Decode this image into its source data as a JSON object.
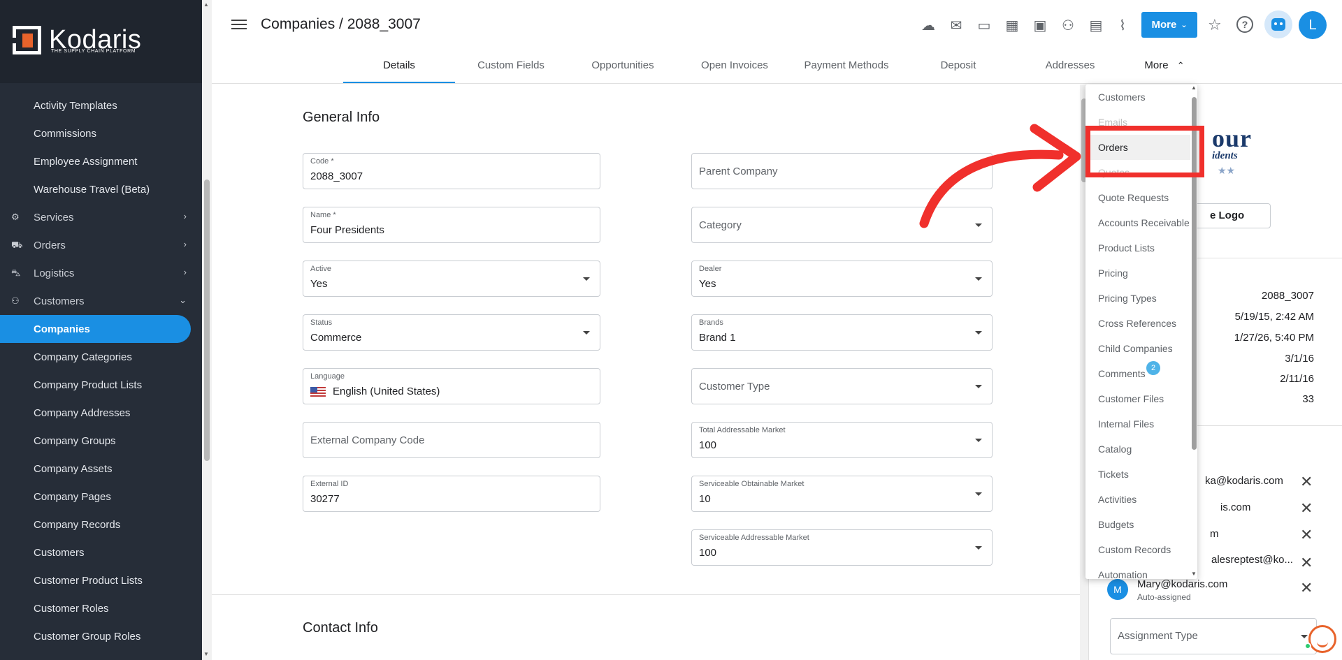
{
  "brand": {
    "name": "Kodaris",
    "tagline": "THE SUPPLY CHAIN PLATFORM",
    "accent": "#1a8fe3",
    "logo_color": "#e8632b"
  },
  "sidebar": {
    "items": [
      {
        "label": "Activity Templates",
        "type": "sub"
      },
      {
        "label": "Commissions",
        "type": "sub"
      },
      {
        "label": "Employee Assignment",
        "type": "sub"
      },
      {
        "label": "Warehouse Travel (Beta)",
        "type": "sub"
      },
      {
        "label": "Services",
        "type": "group",
        "icon": "services-icon"
      },
      {
        "label": "Orders",
        "type": "group",
        "icon": "truck-icon"
      },
      {
        "label": "Logistics",
        "type": "group",
        "icon": "logistics-icon"
      },
      {
        "label": "Customers",
        "type": "group",
        "icon": "people-icon"
      },
      {
        "label": "Companies",
        "type": "active"
      },
      {
        "label": "Company Categories",
        "type": "sub"
      },
      {
        "label": "Company Product Lists",
        "type": "sub"
      },
      {
        "label": "Company Addresses",
        "type": "sub"
      },
      {
        "label": "Company Groups",
        "type": "sub"
      },
      {
        "label": "Company Assets",
        "type": "sub"
      },
      {
        "label": "Company Pages",
        "type": "sub"
      },
      {
        "label": "Company Records",
        "type": "sub"
      },
      {
        "label": "Customers",
        "type": "sub"
      },
      {
        "label": "Customer Product Lists",
        "type": "sub"
      },
      {
        "label": "Customer Roles",
        "type": "sub"
      },
      {
        "label": "Customer Group Roles",
        "type": "sub"
      }
    ]
  },
  "header": {
    "title": "Companies / 2088_3007",
    "more_button": "More",
    "avatar_initial": "L",
    "icons": [
      "cloud-icon",
      "mail-icon",
      "payment-icon",
      "gift-icon",
      "monitor-add-icon",
      "person-add-icon",
      "file-add-icon",
      "attachment-icon"
    ]
  },
  "tabs": [
    {
      "label": "Details",
      "active": true
    },
    {
      "label": "Custom Fields"
    },
    {
      "label": "Opportunities"
    },
    {
      "label": "Open Invoices"
    },
    {
      "label": "Payment Methods"
    },
    {
      "label": "Deposit"
    },
    {
      "label": "Addresses"
    },
    {
      "label": "More"
    }
  ],
  "general_info": {
    "title": "General Info",
    "code": {
      "label": "Code *",
      "value": "2088_3007"
    },
    "parent_company": {
      "placeholder": "Parent Company"
    },
    "name": {
      "label": "Name *",
      "value": "Four Presidents"
    },
    "category": {
      "placeholder": "Category"
    },
    "active": {
      "label": "Active",
      "value": "Yes"
    },
    "dealer": {
      "label": "Dealer",
      "value": "Yes"
    },
    "status": {
      "label": "Status",
      "value": "Commerce"
    },
    "brands": {
      "label": "Brands",
      "value": "Brand 1"
    },
    "language": {
      "label": "Language",
      "value": "English (United States)"
    },
    "customer_type": {
      "placeholder": "Customer Type"
    },
    "external_company_code": {
      "placeholder": "External Company Code"
    },
    "tam": {
      "label": "Total Addressable Market",
      "value": "100"
    },
    "external_id": {
      "label": "External ID",
      "value": "30277"
    },
    "som": {
      "label": "Serviceable Obtainable Market",
      "value": "10"
    },
    "sam": {
      "label": "Serviceable Addressable Market",
      "value": "100"
    }
  },
  "contact_info": {
    "title": "Contact Info"
  },
  "right_panel": {
    "logo_big": "our",
    "logo_small": "idents",
    "logo_stars": "★★",
    "change_logo": "e Logo",
    "info_values": [
      "2088_3007",
      "5/19/15, 2:42 AM",
      "1/27/26, 5:40 PM",
      "3/1/16",
      "2/11/16",
      "33"
    ],
    "assignees": [
      {
        "email": "ka@kodaris.com"
      },
      {
        "email": "is.com"
      },
      {
        "email": "m"
      },
      {
        "email": "alesreptest@ko..."
      },
      {
        "email": "Mary@kodaris.com",
        "sub": "Auto-assigned",
        "initial": "M"
      }
    ],
    "assignment_type": {
      "placeholder": "Assignment Type"
    }
  },
  "dropdown": {
    "items": [
      "Customers",
      "Emails",
      "Orders",
      "Quotes",
      "Quote Requests",
      "Accounts Receivable",
      "Product Lists",
      "Pricing",
      "Pricing Types",
      "Cross References",
      "Child Companies",
      "Comments",
      "Customer Files",
      "Internal Files",
      "Catalog",
      "Tickets",
      "Activities",
      "Budgets",
      "Custom Records",
      "Automation"
    ],
    "comments_badge": "2",
    "highlighted": "Orders"
  }
}
